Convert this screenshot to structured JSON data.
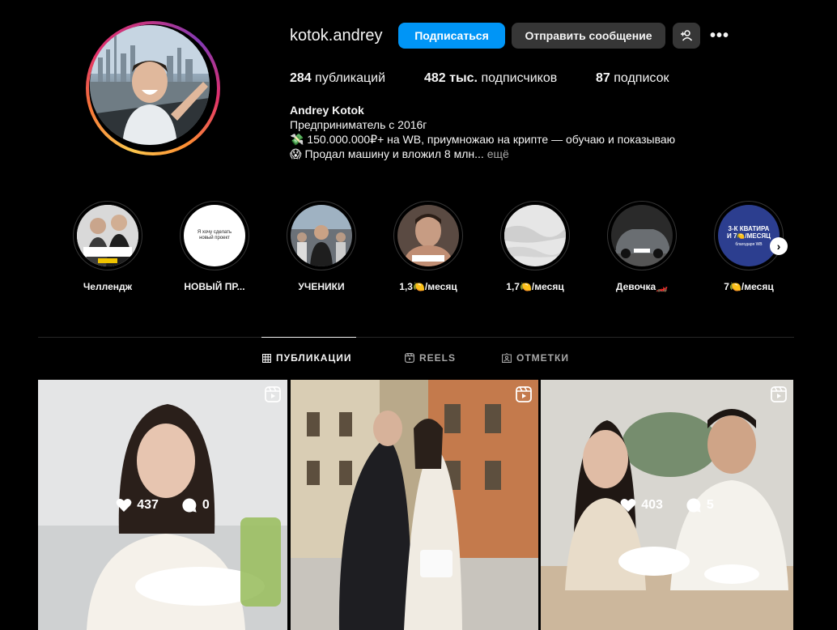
{
  "profile": {
    "username": "kotok.andrey",
    "follow_label": "Подписаться",
    "message_label": "Отправить сообщение",
    "add_user_icon": "add-user-icon",
    "more_label": "•••"
  },
  "stats": {
    "posts_count": "284",
    "posts_label": "публикаций",
    "followers_count": "482 тыс.",
    "followers_label": "подписчиков",
    "following_count": "87",
    "following_label": "подписок"
  },
  "bio": {
    "name": "Andrey Kotok",
    "line1": "Предприниматель с 2016г",
    "line2": "💸 150.000.000₽+ на WB, приумножаю на крипте — обучаю и показываю",
    "line3": "😱 Продал машину и вложил 8 млн...",
    "more": " ещё"
  },
  "highlights": [
    {
      "label": "Челлендж"
    },
    {
      "label": "НОВЫЙ ПР..."
    },
    {
      "label": "УЧЕНИКИ"
    },
    {
      "label": "1,3🍋/месяц"
    },
    {
      "label": "1,7🍋/месяц"
    },
    {
      "label": "Девочка🏎️"
    },
    {
      "label": "7🍋/месяц"
    }
  ],
  "highlight_texts": {
    "h2_text": "Я хочу сделать новый проект",
    "h7_line1": "3-К КВАТИРА",
    "h7_line2": "И 7🍋/МЕСЯЦ",
    "h7_line3": "благодаря WB"
  },
  "tabs": [
    {
      "label": "ПУБЛИКАЦИИ",
      "active": true
    },
    {
      "label": "REELS",
      "active": false
    },
    {
      "label": "ОТМЕТКИ",
      "active": false
    }
  ],
  "posts": [
    {
      "likes": "437",
      "comments": "0",
      "show_overlay": true
    },
    {
      "likes": "",
      "comments": "",
      "show_overlay": false
    },
    {
      "likes": "403",
      "comments": "5",
      "show_overlay": true
    }
  ],
  "colors": {
    "accent": "#0095f6",
    "background": "#000000",
    "button_secondary": "#363636"
  }
}
